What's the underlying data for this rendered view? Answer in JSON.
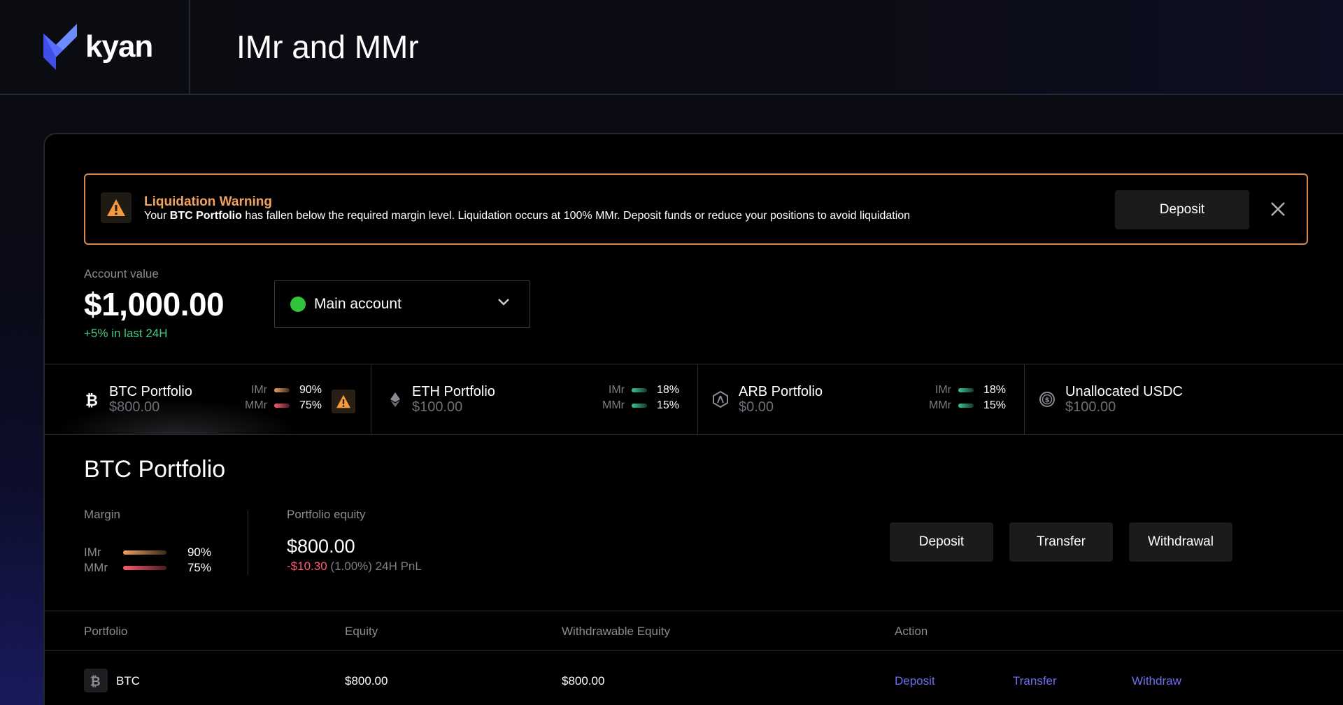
{
  "header": {
    "logo_text": "kyan",
    "title": "IMr and MMr"
  },
  "warning": {
    "title": "Liquidation Warning",
    "msg_prefix": "Your ",
    "msg_bold": "BTC Portfolio",
    "msg_suffix": " has fallen below the required margin level. Liquidation occurs at 100% MMr. Deposit funds or reduce your positions to avoid liquidation",
    "deposit_label": "Deposit",
    "icon": "warning-icon"
  },
  "account": {
    "label": "Account value",
    "value": "$1,000.00",
    "change": "+5% in last 24H",
    "selector_label": "Main account"
  },
  "cards": [
    {
      "name": "BTC Portfolio",
      "amount": "$800.00",
      "imr_label": "IMr",
      "imr": "90%",
      "mmr_label": "MMr",
      "mmr": "75%",
      "icon": "bitcoin-icon"
    },
    {
      "name": "ETH Portfolio",
      "amount": "$100.00",
      "imr_label": "IMr",
      "imr": "18%",
      "mmr_label": "MMr",
      "mmr": "15%",
      "icon": "ethereum-icon"
    },
    {
      "name": "ARB Portfolio",
      "amount": "$0.00",
      "imr_label": "IMr",
      "imr": "18%",
      "mmr_label": "MMr",
      "mmr": "15%",
      "icon": "arbitrum-icon"
    },
    {
      "name": "Unallocated USDC",
      "amount": "$100.00",
      "icon": "usdc-icon"
    }
  ],
  "detail": {
    "title": "BTC Portfolio",
    "margin_label": "Margin",
    "imr_label": "IMr",
    "imr_value": "90%",
    "mmr_label": "MMr",
    "mmr_value": "75%",
    "equity_label": "Portfolio equity",
    "equity_value": "$800.00",
    "pnl_value": "-$10.30",
    "pnl_pct": "(1.00%)",
    "pnl_label": "24H PnL",
    "buttons": {
      "deposit": "Deposit",
      "transfer": "Transfer",
      "withdrawal": "Withdrawal"
    }
  },
  "table": {
    "headers": [
      "Portfolio",
      "Equity",
      "Withdrawable Equity",
      "Action"
    ],
    "rows": [
      {
        "portfolio": "BTC",
        "equity": "$800.00",
        "withdrawable": "$800.00",
        "actions": [
          "Deposit",
          "Transfer",
          "Withdraw"
        ]
      }
    ]
  },
  "colors": {
    "accent": "#6d6df0",
    "warning": "#f0a25e",
    "positive": "#45c77e",
    "negative": "#ff5a6e"
  }
}
